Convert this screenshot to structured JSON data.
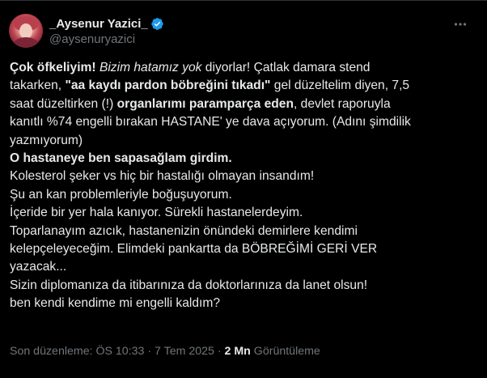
{
  "author": {
    "display_name": "_Aysenur Yazici_",
    "handle": "@aysenuryazici"
  },
  "tweet": {
    "line1": {
      "p1": "Çok öfkeliyim!",
      "p2": " ",
      "p3": "Bizim hatamız yok",
      "p4": " diyorlar! Çatlak damara stend"
    },
    "line2": {
      "p1": "takarken, ",
      "p2": "\"aa kaydı pardon böbreğini tıkadı\"",
      "p3": " gel düzeltelim diyen, 7,5"
    },
    "line3": {
      "p1": "saat düzeltirken (!) ",
      "p2": "organlarımı paramparça eden",
      "p3": ", devlet raporuyla"
    },
    "line4": "kanıtlı %74 engelli bırakan HASTANE' ye dava açıyorum. (Adını şimdilik",
    "line5": "yazmıyorum)",
    "line6": "O hastaneye ben sapasağlam girdim.",
    "line7": "Kolesterol şeker vs hiç bir hastalığı olmayan insandım!",
    "line8": "Şu an kan problemleriyle boğuşuyorum.",
    "line9": "İçeride bir yer hala kanıyor. Sürekli hastanelerdeyim.",
    "line10": "Toparlanayım azıcık, hastanenizin önündeki demirlere kendimi",
    "line11": "kelepçeleyeceğim. Elimdeki pankartta da BÖBREĞİMİ GERİ VER",
    "line12": "yazacak...",
    "line13": "Sizin diplomanıza da itibarınıza da doktorlarınıza da lanet olsun!",
    "line14": "ben kendi kendime mi engelli kaldım?"
  },
  "meta": {
    "edited_label": "Son düzenleme: ÖS 10:33",
    "separator1": " · ",
    "date": "7 Tem 2025",
    "separator2": " · ",
    "views_count": "2 Mn",
    "views_label": " Görüntüleme"
  },
  "icons": {
    "verified": "verified-badge-icon",
    "more": "more-options-icon"
  },
  "colors": {
    "background": "#000000",
    "text_primary": "#e7e9ea",
    "text_secondary": "#71767b",
    "verified_blue": "#1d9bf0"
  }
}
